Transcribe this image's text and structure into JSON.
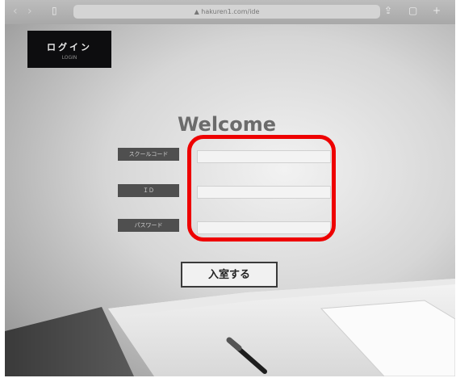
{
  "browser": {
    "url": "▲ hakuren1.com/ide",
    "back_glyph": "‹",
    "forward_glyph": "›",
    "icons": [
      "back-icon",
      "forward-icon",
      "book-icon",
      "share-icon",
      "new-tab-icon"
    ]
  },
  "header": {
    "login_tab_label": "ログイン",
    "login_tab_sublabel": "LOGIN"
  },
  "form": {
    "title": "Welcome",
    "fields": [
      {
        "label": "スクールコード",
        "value": "",
        "placeholder": ""
      },
      {
        "label": "ＩＤ",
        "value": "",
        "placeholder": ""
      },
      {
        "label": "パスワード",
        "value": "",
        "placeholder": ""
      }
    ],
    "submit_label": "入室する"
  },
  "annotation": {
    "color": "#ee0000",
    "target": "input fields"
  }
}
